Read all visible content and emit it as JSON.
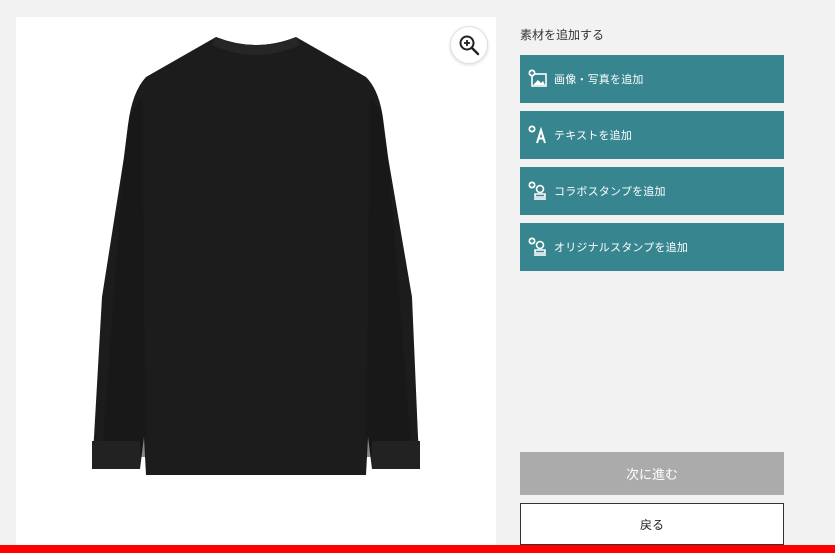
{
  "panel": {
    "title": "素材を追加する",
    "buttons": [
      {
        "label": "画像・写真を追加",
        "icon": "image-add-icon"
      },
      {
        "label": "テキストを追加",
        "icon": "text-add-icon"
      },
      {
        "label": "コラボスタンプを追加",
        "icon": "collab-stamp-add-icon"
      },
      {
        "label": "オリジナルスタンプを追加",
        "icon": "original-stamp-add-icon"
      }
    ]
  },
  "actions": {
    "next_label": "次に進む",
    "back_label": "戻る"
  },
  "product": {
    "view": "back",
    "color": "#1c1c1c"
  },
  "colors": {
    "accent": "#37858f",
    "disabled": "#ababab",
    "brand_bar": "#ff0000"
  }
}
